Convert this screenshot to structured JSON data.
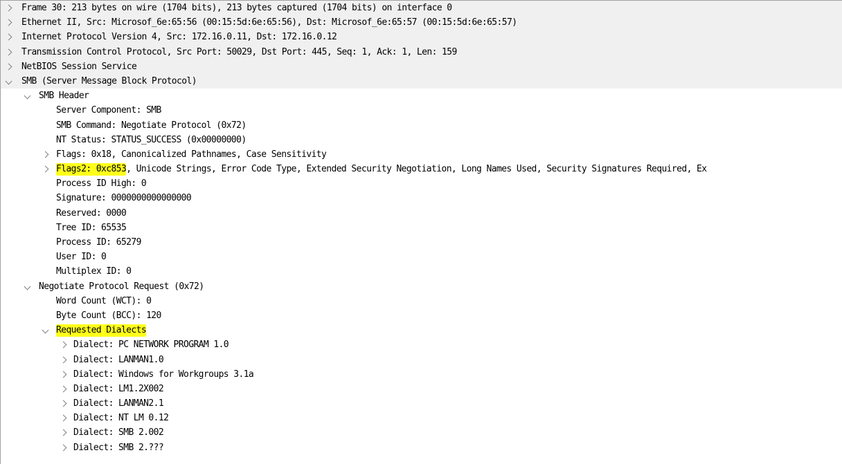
{
  "packet_details": {
    "frame": {
      "label": "Frame 30: 213 bytes on wire (1704 bits), 213 bytes captured (1704 bits) on interface 0",
      "expanded": false
    },
    "ethernet": {
      "label": "Ethernet II, Src: Microsof_6e:65:56 (00:15:5d:6e:65:56), Dst: Microsof_6e:65:57 (00:15:5d:6e:65:57)",
      "expanded": false
    },
    "ip": {
      "label": "Internet Protocol Version 4, Src: 172.16.0.11, Dst: 172.16.0.12",
      "expanded": false
    },
    "tcp": {
      "label": "Transmission Control Protocol, Src Port: 50029, Dst Port: 445, Seq: 1, Ack: 1, Len: 159",
      "expanded": false
    },
    "netbios": {
      "label": "NetBIOS Session Service",
      "expanded": false
    },
    "smb": {
      "label": "SMB (Server Message Block Protocol)",
      "expanded": true,
      "header": {
        "label": "SMB Header",
        "expanded": true,
        "server_component": "Server Component: SMB",
        "command": "SMB Command: Negotiate Protocol (0x72)",
        "nt_status": "NT Status: STATUS_SUCCESS (0x00000000)",
        "flags": "Flags: 0x18, Canonicalized Pathnames, Case Sensitivity",
        "flags2_highlighted": "Flags2: 0xc853",
        "flags2_rest": ", Unicode Strings, Error Code Type, Extended Security Negotiation, Long Names Used, Security Signatures Required, Ex",
        "process_id_high": "Process ID High: 0",
        "signature": "Signature: 0000000000000000",
        "reserved": "Reserved: 0000",
        "tree_id": "Tree ID: 65535",
        "process_id": "Process ID: 65279",
        "user_id": "User ID: 0",
        "multiplex_id": "Multiplex ID: 0"
      },
      "negotiate": {
        "label": "Negotiate Protocol Request (0x72)",
        "expanded": true,
        "word_count": "Word Count (WCT): 0",
        "byte_count": "Byte Count (BCC): 120",
        "requested_dialects": {
          "label": "Requested Dialects",
          "expanded": true,
          "items": [
            "Dialect: PC NETWORK PROGRAM 1.0",
            "Dialect: LANMAN1.0",
            "Dialect: Windows for Workgroups 3.1a",
            "Dialect: LM1.2X002",
            "Dialect: LANMAN2.1",
            "Dialect: NT LM 0.12",
            "Dialect: SMB 2.002",
            "Dialect: SMB 2.???"
          ]
        }
      }
    }
  },
  "colors": {
    "highlight": "#ffff1a",
    "top_level_row_bg": "#f0f0f0",
    "arrow": "#808080"
  },
  "icons": {
    "collapsed": "chevron-right-icon",
    "expanded": "chevron-down-icon"
  }
}
